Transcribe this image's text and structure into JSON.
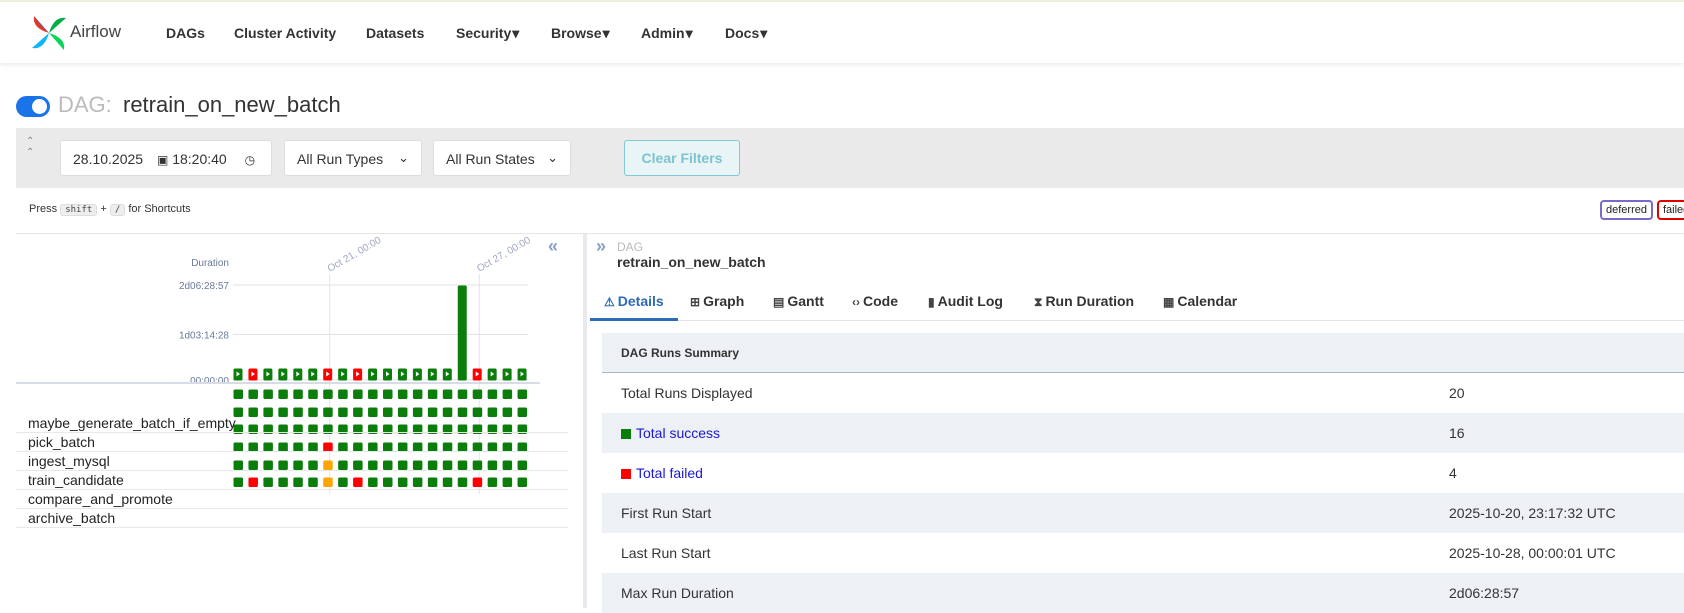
{
  "app": {
    "name": "Airflow",
    "nav": [
      {
        "label": "DAGs",
        "caret": false
      },
      {
        "label": "Cluster Activity",
        "caret": false
      },
      {
        "label": "Datasets",
        "caret": false
      },
      {
        "label": "Security",
        "caret": true
      },
      {
        "label": "Browse",
        "caret": true
      },
      {
        "label": "Admin",
        "caret": true
      },
      {
        "label": "Docs",
        "caret": true
      }
    ]
  },
  "dag": {
    "prefix": "DAG:",
    "name": "retrain_on_new_batch",
    "paused": false
  },
  "filters": {
    "date": "28.10.2025",
    "time": "18:20:40",
    "run_types": "All Run Types",
    "run_states": "All Run States",
    "clear_label": "Clear Filters"
  },
  "shortcuts": {
    "press": "Press",
    "key1": "shift",
    "plus": "+",
    "key2": "/",
    "suffix": "for Shortcuts"
  },
  "legend": [
    {
      "label": "deferred",
      "color": "#7b68c9"
    },
    {
      "label": "failed",
      "color": "#e00000"
    }
  ],
  "grid": {
    "duration_label": "Duration",
    "y_ticks": [
      "2d06:28:57",
      "1d03:14:28",
      "00:00:00"
    ],
    "date_markers": [
      "Oct 21, 00:00",
      "Oct 27, 00:00"
    ],
    "tasks": [
      "maybe_generate_batch_if_empty",
      "pick_batch",
      "ingest_mysql",
      "train_candidate",
      "compare_and_promote",
      "archive_batch"
    ],
    "colors": {
      "success": "#0a7d0a",
      "failed": "#ff0000",
      "upstream_failed": "#ffa500"
    }
  },
  "chart_data": {
    "type": "bar",
    "title": "",
    "ylabel": "Duration",
    "y_ticks": [
      "00:00:00",
      "1d03:14:28",
      "2d06:28:57"
    ],
    "ylim_seconds": [
      0,
      196137
    ],
    "runs": [
      {
        "state": "success",
        "duration_s": 0
      },
      {
        "state": "failed",
        "duration_s": 0
      },
      {
        "state": "success",
        "duration_s": 0
      },
      {
        "state": "success",
        "duration_s": 0
      },
      {
        "state": "success",
        "duration_s": 0
      },
      {
        "state": "success",
        "duration_s": 0
      },
      {
        "state": "failed",
        "duration_s": 0
      },
      {
        "state": "success",
        "duration_s": 0
      },
      {
        "state": "failed",
        "duration_s": 0
      },
      {
        "state": "success",
        "duration_s": 0
      },
      {
        "state": "success",
        "duration_s": 0
      },
      {
        "state": "success",
        "duration_s": 0
      },
      {
        "state": "success",
        "duration_s": 0
      },
      {
        "state": "success",
        "duration_s": 0
      },
      {
        "state": "success",
        "duration_s": 0
      },
      {
        "state": "success",
        "duration_s": 196137
      },
      {
        "state": "failed",
        "duration_s": 0
      },
      {
        "state": "success",
        "duration_s": 0
      },
      {
        "state": "success",
        "duration_s": 0
      },
      {
        "state": "success",
        "duration_s": 0
      }
    ],
    "task_states": [
      [
        "s",
        "s",
        "s",
        "s",
        "s",
        "s",
        "s",
        "s",
        "s",
        "s",
        "s",
        "s",
        "s",
        "s",
        "s",
        "s",
        "s",
        "s",
        "s",
        "s"
      ],
      [
        "s",
        "s",
        "s",
        "s",
        "s",
        "s",
        "s",
        "s",
        "s",
        "s",
        "s",
        "s",
        "s",
        "s",
        "s",
        "s",
        "s",
        "s",
        "s",
        "s"
      ],
      [
        "s",
        "s",
        "s",
        "s",
        "s",
        "s",
        "s",
        "s",
        "s",
        "s",
        "s",
        "s",
        "s",
        "s",
        "s",
        "s",
        "s",
        "s",
        "s",
        "s"
      ],
      [
        "s",
        "s",
        "s",
        "s",
        "s",
        "s",
        "f",
        "s",
        "s",
        "s",
        "s",
        "s",
        "s",
        "s",
        "s",
        "s",
        "s",
        "s",
        "s",
        "s"
      ],
      [
        "s",
        "s",
        "s",
        "s",
        "s",
        "s",
        "u",
        "s",
        "s",
        "s",
        "s",
        "s",
        "s",
        "s",
        "s",
        "s",
        "s",
        "s",
        "s",
        "s"
      ],
      [
        "s",
        "f",
        "s",
        "s",
        "s",
        "s",
        "u",
        "s",
        "f",
        "s",
        "s",
        "s",
        "s",
        "s",
        "s",
        "s",
        "f",
        "s",
        "s",
        "s"
      ]
    ]
  },
  "details": {
    "crumb_small": "DAG",
    "crumb_big": "retrain_on_new_batch",
    "tabs": [
      {
        "label": "Details",
        "icon": "warning-icon",
        "glyph": "⚠"
      },
      {
        "label": "Graph",
        "icon": "graph-icon",
        "glyph": "⊞"
      },
      {
        "label": "Gantt",
        "icon": "gantt-icon",
        "glyph": "▤"
      },
      {
        "label": "Code",
        "icon": "code-icon",
        "glyph": "‹›"
      },
      {
        "label": "Audit Log",
        "icon": "audit-log-icon",
        "glyph": "▮"
      },
      {
        "label": "Run Duration",
        "icon": "hourglass-icon",
        "glyph": "⧗"
      },
      {
        "label": "Calendar",
        "icon": "calendar-icon",
        "glyph": "▦"
      }
    ],
    "summary_title": "DAG Runs Summary",
    "summary": [
      {
        "key": "Total Runs Displayed",
        "value": "20"
      },
      {
        "key": "Total success",
        "value": "16",
        "color": "#0a7d0a"
      },
      {
        "key": "Total failed",
        "value": "4",
        "color": "#ff0000"
      },
      {
        "key": "First Run Start",
        "value": "2025-10-20, 23:17:32 UTC"
      },
      {
        "key": "Last Run Start",
        "value": "2025-10-28, 00:00:01 UTC"
      },
      {
        "key": "Max Run Duration",
        "value": "2d06:28:57"
      }
    ]
  }
}
